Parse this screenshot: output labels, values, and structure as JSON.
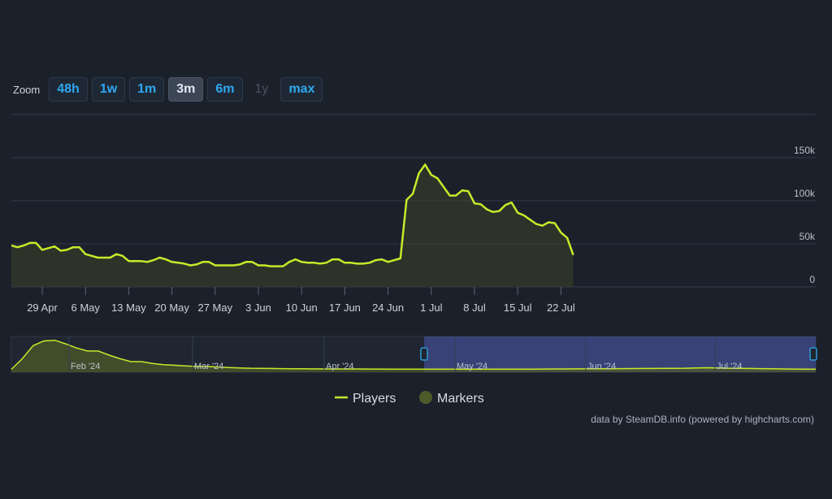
{
  "zoom": {
    "label": "Zoom",
    "buttons": [
      {
        "label": "48h",
        "state": "normal"
      },
      {
        "label": "1w",
        "state": "normal"
      },
      {
        "label": "1m",
        "state": "normal"
      },
      {
        "label": "3m",
        "state": "active"
      },
      {
        "label": "6m",
        "state": "normal"
      },
      {
        "label": "1y",
        "state": "disabled"
      },
      {
        "label": "max",
        "state": "normal"
      }
    ]
  },
  "credit": "data by SteamDB.info (powered by highcharts.com)",
  "colors": {
    "background": "#1b212b",
    "line": "#c6ea2a",
    "area": "#3c4426",
    "marker": "#4d5a2a",
    "grid": "#323b48",
    "navigator_selection": "#3f4a8a",
    "handle": "#2d9ad6"
  },
  "chart_data": [
    {
      "type": "line",
      "title": "",
      "xlabel": "",
      "ylabel": "",
      "ylim": [
        0,
        150000
      ],
      "y_ticks": [
        "0",
        "50k",
        "100k",
        "150k"
      ],
      "x_ticks": [
        "29 Apr",
        "6 May",
        "13 May",
        "20 May",
        "27 May",
        "3 Jun",
        "10 Jun",
        "17 Jun",
        "24 Jun",
        "1 Jul",
        "8 Jul",
        "15 Jul",
        "22 Jul"
      ],
      "grid": true,
      "legend_position": "bottom-center",
      "series": [
        {
          "name": "Players",
          "x": [
            "24 Apr",
            "25 Apr",
            "26 Apr",
            "27 Apr",
            "28 Apr",
            "29 Apr",
            "30 Apr",
            "1 May",
            "2 May",
            "3 May",
            "4 May",
            "5 May",
            "6 May",
            "7 May",
            "8 May",
            "9 May",
            "10 May",
            "11 May",
            "12 May",
            "13 May",
            "14 May",
            "15 May",
            "16 May",
            "17 May",
            "18 May",
            "19 May",
            "20 May",
            "21 May",
            "22 May",
            "23 May",
            "24 May",
            "25 May",
            "26 May",
            "27 May",
            "28 May",
            "29 May",
            "30 May",
            "31 May",
            "1 Jun",
            "2 Jun",
            "3 Jun",
            "4 Jun",
            "5 Jun",
            "6 Jun",
            "7 Jun",
            "8 Jun",
            "9 Jun",
            "10 Jun",
            "11 Jun",
            "12 Jun",
            "13 Jun",
            "14 Jun",
            "15 Jun",
            "16 Jun",
            "17 Jun",
            "18 Jun",
            "19 Jun",
            "20 Jun",
            "21 Jun",
            "22 Jun",
            "23 Jun",
            "24 Jun",
            "25 Jun",
            "26 Jun",
            "27 Jun",
            "28 Jun",
            "29 Jun",
            "30 Jun",
            "1 Jul",
            "2 Jul",
            "3 Jul",
            "4 Jul",
            "5 Jul",
            "6 Jul",
            "7 Jul",
            "8 Jul",
            "9 Jul",
            "10 Jul",
            "11 Jul",
            "12 Jul",
            "13 Jul",
            "14 Jul",
            "15 Jul",
            "16 Jul",
            "17 Jul",
            "18 Jul",
            "19 Jul",
            "20 Jul",
            "21 Jul",
            "22 Jul",
            "23 Jul",
            "24 Jul"
          ],
          "values": [
            48000,
            46000,
            48000,
            51000,
            51000,
            43000,
            45000,
            47000,
            42000,
            43000,
            46000,
            46000,
            38000,
            36000,
            34000,
            34000,
            34000,
            38000,
            36000,
            30000,
            30000,
            30000,
            29000,
            31000,
            34000,
            32000,
            29000,
            28000,
            27000,
            25000,
            26000,
            29000,
            29000,
            25000,
            25000,
            25000,
            25000,
            26000,
            29000,
            29000,
            25000,
            25000,
            24000,
            24000,
            24000,
            29000,
            32000,
            29000,
            28000,
            28000,
            27000,
            28000,
            32000,
            32000,
            28000,
            28000,
            27000,
            27000,
            28000,
            31000,
            32000,
            29000,
            31000,
            33000,
            101000,
            108000,
            132000,
            142000,
            130000,
            126000,
            116000,
            106000,
            106000,
            112000,
            111000,
            97000,
            96000,
            90000,
            87000,
            88000,
            95000,
            98000,
            86000,
            83000,
            78000,
            73000,
            71000,
            75000,
            74000,
            63000,
            57000,
            37000
          ]
        },
        {
          "name": "Markers",
          "values": []
        }
      ]
    },
    {
      "type": "area",
      "title": "",
      "x_ticks": [
        "Feb '24",
        "Mar '24",
        "Apr '24",
        "May '24",
        "Jun '24",
        "Jul '24"
      ],
      "selected_range": [
        "24 Apr",
        "24 Jul"
      ],
      "series": [
        {
          "name": "Players",
          "values": [
            20000,
            200000,
            420000,
            500000,
            510000,
            450000,
            380000,
            330000,
            330000,
            260000,
            200000,
            150000,
            150000,
            120000,
            100000,
            90000,
            80000,
            70000,
            70000,
            60000,
            50000,
            45000,
            40000,
            38000,
            35000,
            33000,
            31000,
            30000,
            29000,
            28000,
            27000,
            27000,
            27000,
            26000,
            26000,
            25000,
            25000,
            25000,
            24000,
            24000,
            24000,
            24000,
            24000,
            24000,
            24000,
            24000,
            24000,
            24000,
            25000,
            26000,
            27000,
            28000,
            29000,
            30000,
            31000,
            32000,
            33000,
            34000,
            35000,
            36000,
            37000,
            38000,
            40000,
            45000,
            48000,
            45000,
            40000,
            38000,
            36000,
            33000,
            30000,
            28000,
            26000,
            24000,
            23000
          ]
        }
      ]
    }
  ]
}
